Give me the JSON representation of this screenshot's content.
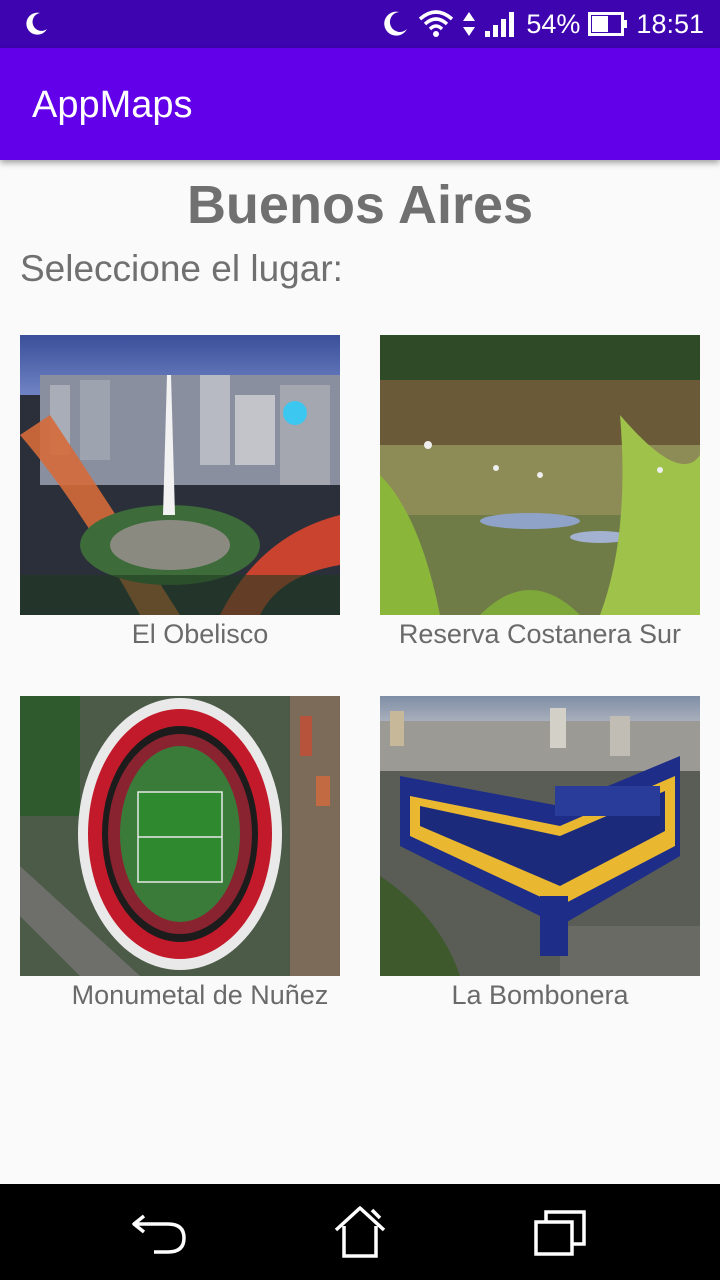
{
  "status_bar": {
    "battery_percent": "54%",
    "time": "18:51",
    "icons": [
      "moon-icon",
      "wifi-icon",
      "signal-icon",
      "battery-icon"
    ]
  },
  "app_bar": {
    "title": "AppMaps"
  },
  "main": {
    "city_title": "Buenos Aires",
    "prompt": "Seleccione el lugar:",
    "places": [
      {
        "name": "El Obelisco"
      },
      {
        "name": "Reserva Costanera Sur"
      },
      {
        "name": "Monumetal de Nuñez"
      },
      {
        "name": "La Bombonera"
      }
    ]
  },
  "nav_bar": {
    "buttons": [
      "back-icon",
      "home-icon",
      "recents-icon"
    ]
  },
  "colors": {
    "status_bar": "#3d04b0",
    "app_bar": "#6200ea",
    "text_gray": "#707070"
  }
}
